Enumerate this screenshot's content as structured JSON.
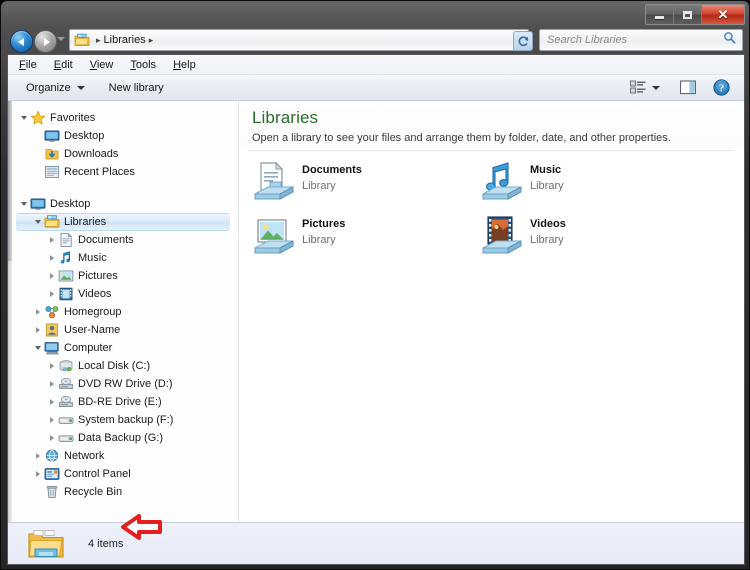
{
  "window": {
    "controls": {
      "minimize_label": "Minimize",
      "maximize_label": "Maximize",
      "close_label": "✕"
    }
  },
  "addressbar": {
    "back_label": "Back",
    "forward_label": "Forward",
    "recent_label": "Recent pages",
    "icon": "libraries-icon",
    "crumbs": [
      "Libraries"
    ],
    "separator": "▸",
    "dropdown_label": "Previous locations",
    "refresh_label": "Refresh"
  },
  "search": {
    "placeholder": "Search Libraries",
    "icon": "search-icon"
  },
  "menubar": {
    "items": [
      {
        "pre": "",
        "key": "F",
        "post": "ile"
      },
      {
        "pre": "",
        "key": "E",
        "post": "dit"
      },
      {
        "pre": "",
        "key": "V",
        "post": "iew"
      },
      {
        "pre": "",
        "key": "T",
        "post": "ools"
      },
      {
        "pre": "",
        "key": "H",
        "post": "elp"
      }
    ]
  },
  "toolbar": {
    "organize_label": "Organize",
    "new_library_label": "New library",
    "view_icon": "view-options-icon",
    "preview_icon": "preview-pane-icon",
    "help_icon": "help-icon"
  },
  "sidebar": {
    "groups": [
      {
        "name": "favorites",
        "nodes": [
          {
            "label": "Favorites",
            "icon": "star-icon",
            "indent": 0,
            "expander": "open"
          },
          {
            "label": "Desktop",
            "icon": "desktop-icon",
            "indent": 1,
            "expander": "none"
          },
          {
            "label": "Downloads",
            "icon": "downloads-icon",
            "indent": 1,
            "expander": "none"
          },
          {
            "label": "Recent Places",
            "icon": "recent-places-icon",
            "indent": 1,
            "expander": "none"
          }
        ]
      },
      {
        "name": "desktop",
        "nodes": [
          {
            "label": "Desktop",
            "icon": "desktop-icon",
            "indent": 0,
            "expander": "open"
          },
          {
            "label": "Libraries",
            "icon": "libraries-icon",
            "indent": 1,
            "expander": "open",
            "selected": true
          },
          {
            "label": "Documents",
            "icon": "documents-icon",
            "indent": 2,
            "expander": "closed"
          },
          {
            "label": "Music",
            "icon": "music-icon",
            "indent": 2,
            "expander": "closed"
          },
          {
            "label": "Pictures",
            "icon": "pictures-icon",
            "indent": 2,
            "expander": "closed"
          },
          {
            "label": "Videos",
            "icon": "videos-icon",
            "indent": 2,
            "expander": "closed"
          },
          {
            "label": "Homegroup",
            "icon": "homegroup-icon",
            "indent": 1,
            "expander": "closed"
          },
          {
            "label": "User-Name",
            "icon": "user-icon",
            "indent": 1,
            "expander": "closed"
          },
          {
            "label": "Computer",
            "icon": "computer-icon",
            "indent": 1,
            "expander": "open"
          },
          {
            "label": "Local Disk (C:)",
            "icon": "local-disk-icon",
            "indent": 2,
            "expander": "closed"
          },
          {
            "label": "DVD RW Drive (D:)",
            "icon": "optical-drive-icon",
            "indent": 2,
            "expander": "closed"
          },
          {
            "label": "BD-RE Drive (E:)",
            "icon": "optical-drive-icon",
            "indent": 2,
            "expander": "closed"
          },
          {
            "label": "System backup (F:)",
            "icon": "removable-drive-icon",
            "indent": 2,
            "expander": "closed"
          },
          {
            "label": "Data Backup (G:)",
            "icon": "removable-drive-icon",
            "indent": 2,
            "expander": "closed"
          },
          {
            "label": "Network",
            "icon": "network-icon",
            "indent": 1,
            "expander": "closed"
          },
          {
            "label": "Control Panel",
            "icon": "control-panel-icon",
            "indent": 1,
            "expander": "closed"
          },
          {
            "label": "Recycle Bin",
            "icon": "recycle-bin-icon",
            "indent": 1,
            "expander": "none"
          }
        ]
      }
    ]
  },
  "content": {
    "title": "Libraries",
    "subtitle": "Open a library to see your files and arrange them by folder, date, and other properties.",
    "items": [
      {
        "name": "Documents",
        "sub": "Library",
        "icon": "documents-library-icon"
      },
      {
        "name": "Music",
        "sub": "Library",
        "icon": "music-library-icon"
      },
      {
        "name": "Pictures",
        "sub": "Library",
        "icon": "pictures-library-icon"
      },
      {
        "name": "Videos",
        "sub": "Library",
        "icon": "videos-library-icon"
      }
    ]
  },
  "statusbar": {
    "icon": "libraries-folder-icon",
    "text": "4 items"
  },
  "annotation": {
    "arrow": "red-left-arrow",
    "points_at": "Control Panel",
    "color": "#e41f1f"
  },
  "colors": {
    "title_accent": "#2b6b2b",
    "selection": "#cfe4f8",
    "close_button": "#d2452f",
    "annotation_red": "#e41f1f"
  }
}
